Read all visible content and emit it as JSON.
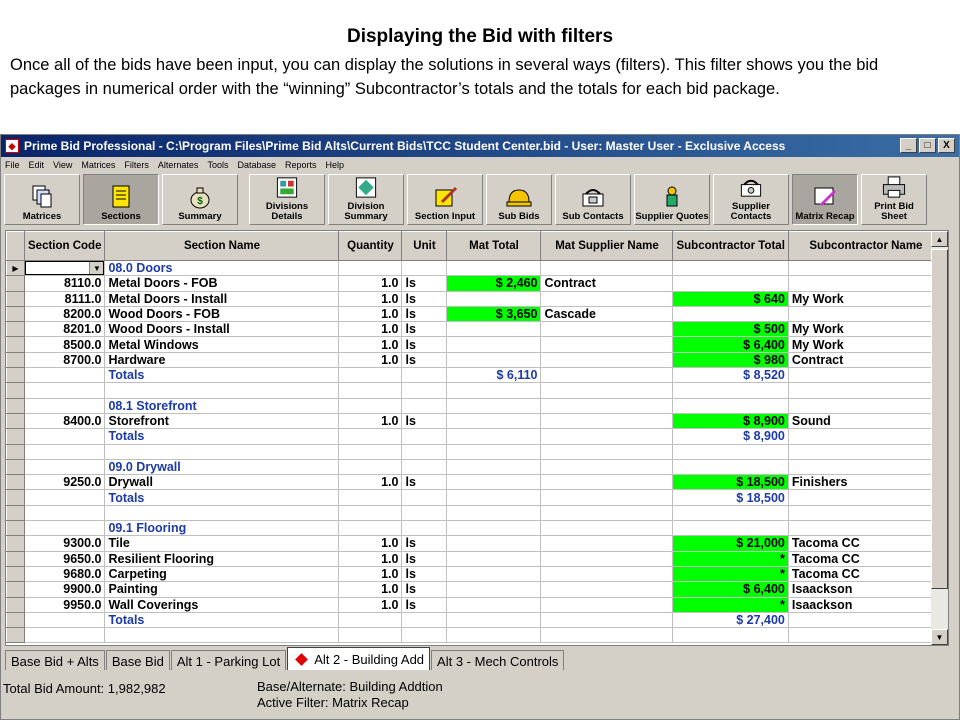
{
  "slide": {
    "title": "Displaying the Bid with filters",
    "body": "Once all of the bids have been input, you can display the solutions in several ways (filters). This filter shows you the bid packages in numerical order with the “winning” Subcontractor’s totals and the totals for each bid package."
  },
  "window": {
    "title": "Prime Bid Professional - C:\\Program Files\\Prime Bid Alts\\Current Bids\\TCC Student Center.bid - User: Master User - Exclusive Access",
    "minimize": "_",
    "maximize": "□",
    "close": "X"
  },
  "menu": [
    "File",
    "Edit",
    "View",
    "Matrices",
    "Filters",
    "Alternates",
    "Tools",
    "Database",
    "Reports",
    "Help"
  ],
  "toolbar": {
    "matrices": "Matrices",
    "sections": "Sections",
    "summary": "Summary",
    "divisions_details": "Divisions Details",
    "division_summary": "Division Summary",
    "section_input": "Section Input",
    "sub_bids": "Sub Bids",
    "sub_contacts": "Sub Contacts",
    "supplier_quotes": "Supplier Quotes",
    "supplier_contacts": "Supplier Contacts",
    "matrix_recap": "Matrix Recap",
    "print_bid_sheet": "Print Bid Sheet"
  },
  "columns": {
    "code": "Section Code",
    "name": "Section Name",
    "qty": "Quantity",
    "unit": "Unit",
    "mat_total": "Mat Total",
    "mat_supplier": "Mat Supplier Name",
    "sub_total": "Subcontractor Total",
    "sub_name": "Subcontractor Name"
  },
  "rows": [
    {
      "kind": "section",
      "name": "08.0 Doors"
    },
    {
      "kind": "item",
      "code": "8110.0",
      "name": "Metal Doors - FOB",
      "qty": "1.0",
      "unit": "ls",
      "mat": "$ 2,460",
      "mat_supplier": "Contract",
      "sub": "",
      "sub_name": ""
    },
    {
      "kind": "item",
      "code": "8111.0",
      "name": "Metal Doors - Install",
      "qty": "1.0",
      "unit": "ls",
      "mat": "",
      "mat_supplier": "",
      "sub": "$ 640",
      "sub_name": "My Work"
    },
    {
      "kind": "item",
      "code": "8200.0",
      "name": "Wood Doors - FOB",
      "qty": "1.0",
      "unit": "ls",
      "mat": "$ 3,650",
      "mat_supplier": "Cascade",
      "sub": "",
      "sub_name": ""
    },
    {
      "kind": "item",
      "code": "8201.0",
      "name": "Wood Doors - Install",
      "qty": "1.0",
      "unit": "ls",
      "mat": "",
      "mat_supplier": "",
      "sub": "$ 500",
      "sub_name": "My Work"
    },
    {
      "kind": "item",
      "code": "8500.0",
      "name": "Metal Windows",
      "qty": "1.0",
      "unit": "ls",
      "mat": "",
      "mat_supplier": "",
      "sub": "$ 6,400",
      "sub_name": "My Work"
    },
    {
      "kind": "item",
      "code": "8700.0",
      "name": "Hardware",
      "qty": "1.0",
      "unit": "ls",
      "mat": "",
      "mat_supplier": "",
      "sub": "$ 980",
      "sub_name": "Contract"
    },
    {
      "kind": "totals",
      "name": "Totals",
      "mat": "$ 6,110",
      "sub": "$ 8,520"
    },
    {
      "kind": "blank"
    },
    {
      "kind": "section",
      "name": "08.1 Storefront"
    },
    {
      "kind": "item",
      "code": "8400.0",
      "name": "Storefront",
      "qty": "1.0",
      "unit": "ls",
      "mat": "",
      "mat_supplier": "",
      "sub": "$ 8,900",
      "sub_name": "Sound"
    },
    {
      "kind": "totals",
      "name": "Totals",
      "mat": "",
      "sub": "$ 8,900"
    },
    {
      "kind": "blank"
    },
    {
      "kind": "section",
      "name": "09.0 Drywall"
    },
    {
      "kind": "item",
      "code": "9250.0",
      "name": "Drywall",
      "qty": "1.0",
      "unit": "ls",
      "mat": "",
      "mat_supplier": "",
      "sub": "$ 18,500",
      "sub_name": "Finishers"
    },
    {
      "kind": "totals",
      "name": "Totals",
      "mat": "",
      "sub": "$ 18,500"
    },
    {
      "kind": "blank"
    },
    {
      "kind": "section",
      "name": "09.1 Flooring"
    },
    {
      "kind": "item",
      "code": "9300.0",
      "name": "Tile",
      "qty": "1.0",
      "unit": "ls",
      "mat": "",
      "mat_supplier": "",
      "sub": "$ 21,000",
      "sub_name": "Tacoma CC"
    },
    {
      "kind": "item",
      "code": "9650.0",
      "name": "Resilient Flooring",
      "qty": "1.0",
      "unit": "ls",
      "mat": "",
      "mat_supplier": "",
      "sub": "*",
      "sub_name": "Tacoma CC"
    },
    {
      "kind": "item",
      "code": "9680.0",
      "name": "Carpeting",
      "qty": "1.0",
      "unit": "ls",
      "mat": "",
      "mat_supplier": "",
      "sub": "*",
      "sub_name": "Tacoma CC"
    },
    {
      "kind": "item",
      "code": "9900.0",
      "name": "Painting",
      "qty": "1.0",
      "unit": "ls",
      "mat": "",
      "mat_supplier": "",
      "sub": "$ 6,400",
      "sub_name": "Isaackson"
    },
    {
      "kind": "item",
      "code": "9950.0",
      "name": "Wall Coverings",
      "qty": "1.0",
      "unit": "ls",
      "mat": "",
      "mat_supplier": "",
      "sub": "*",
      "sub_name": "Isaackson"
    },
    {
      "kind": "totals",
      "name": "Totals",
      "mat": "",
      "sub": "$ 27,400"
    },
    {
      "kind": "blank"
    }
  ],
  "tabs": [
    "Base Bid + Alts",
    "Base Bid",
    "Alt 1 - Parking Lot",
    "Alt 2 - Building Add",
    "Alt 3 - Mech Controls"
  ],
  "status": {
    "total": "Total Bid Amount: 1,982,982",
    "base": "Base/Alternate: Building Addtion",
    "filter": "Active Filter: Matrix Recap"
  },
  "colors": {
    "highlight": "#00ff00",
    "section_text": "#1c3aa9",
    "titlebar": "#0a246a"
  }
}
